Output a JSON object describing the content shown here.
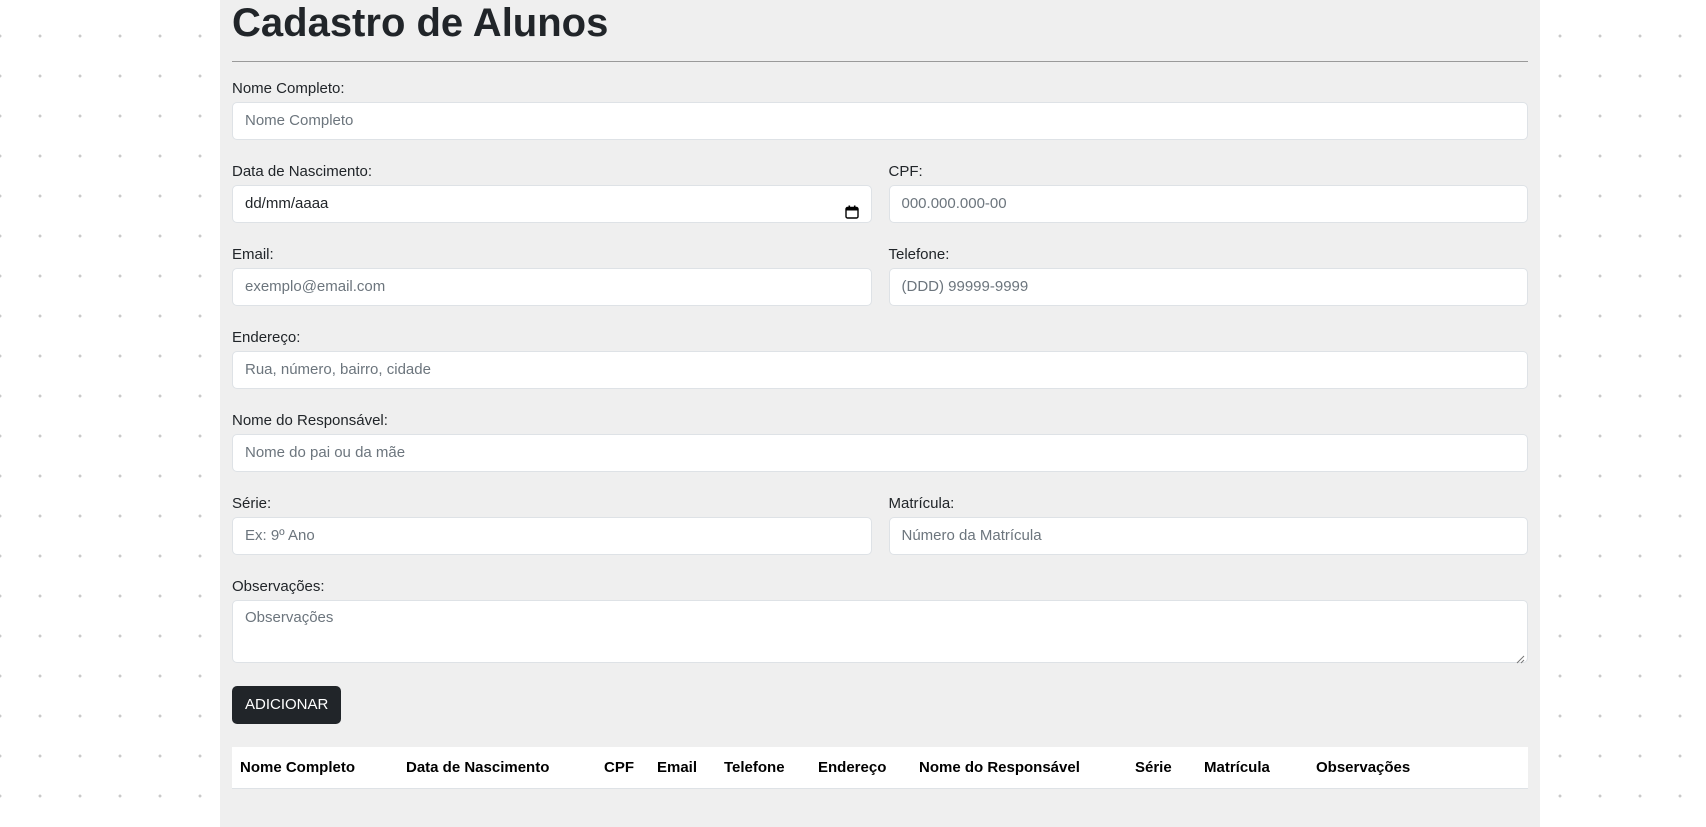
{
  "form": {
    "title": "Cadastro de Alunos",
    "fields": {
      "nome": {
        "label": "Nome Completo:",
        "placeholder": "Nome Completo"
      },
      "nascimento": {
        "label": "Data de Nascimento:",
        "placeholder": "dd/mm/aaaa"
      },
      "cpf": {
        "label": "CPF:",
        "placeholder": "000.000.000-00"
      },
      "email": {
        "label": "Email:",
        "placeholder": "exemplo@email.com"
      },
      "telefone": {
        "label": "Telefone:",
        "placeholder": "(DDD) 99999-9999"
      },
      "endereco": {
        "label": "Endereço:",
        "placeholder": "Rua, número, bairro, cidade"
      },
      "responsavel": {
        "label": "Nome do Responsável:",
        "placeholder": "Nome do pai ou da mãe"
      },
      "serie": {
        "label": "Série:",
        "placeholder": "Ex: 9º Ano"
      },
      "matricula": {
        "label": "Matrícula:",
        "placeholder": "Número da Matrícula"
      },
      "observacoes": {
        "label": "Observações:",
        "placeholder": "Observações"
      }
    },
    "submit_label": "ADICIONAR"
  },
  "table": {
    "columns": [
      "Nome Completo",
      "Data de Nascimento",
      "CPF",
      "Email",
      "Telefone",
      "Endereço",
      "Nome do Responsável",
      "Série",
      "Matrícula",
      "Observações"
    ]
  },
  "icons": {
    "date_picker": "calendar-icon",
    "textarea_resize": "resize-grip-icon"
  },
  "colors": {
    "page_bg": "#efefef",
    "button_bg": "#212529",
    "button_text": "#ffffff"
  }
}
